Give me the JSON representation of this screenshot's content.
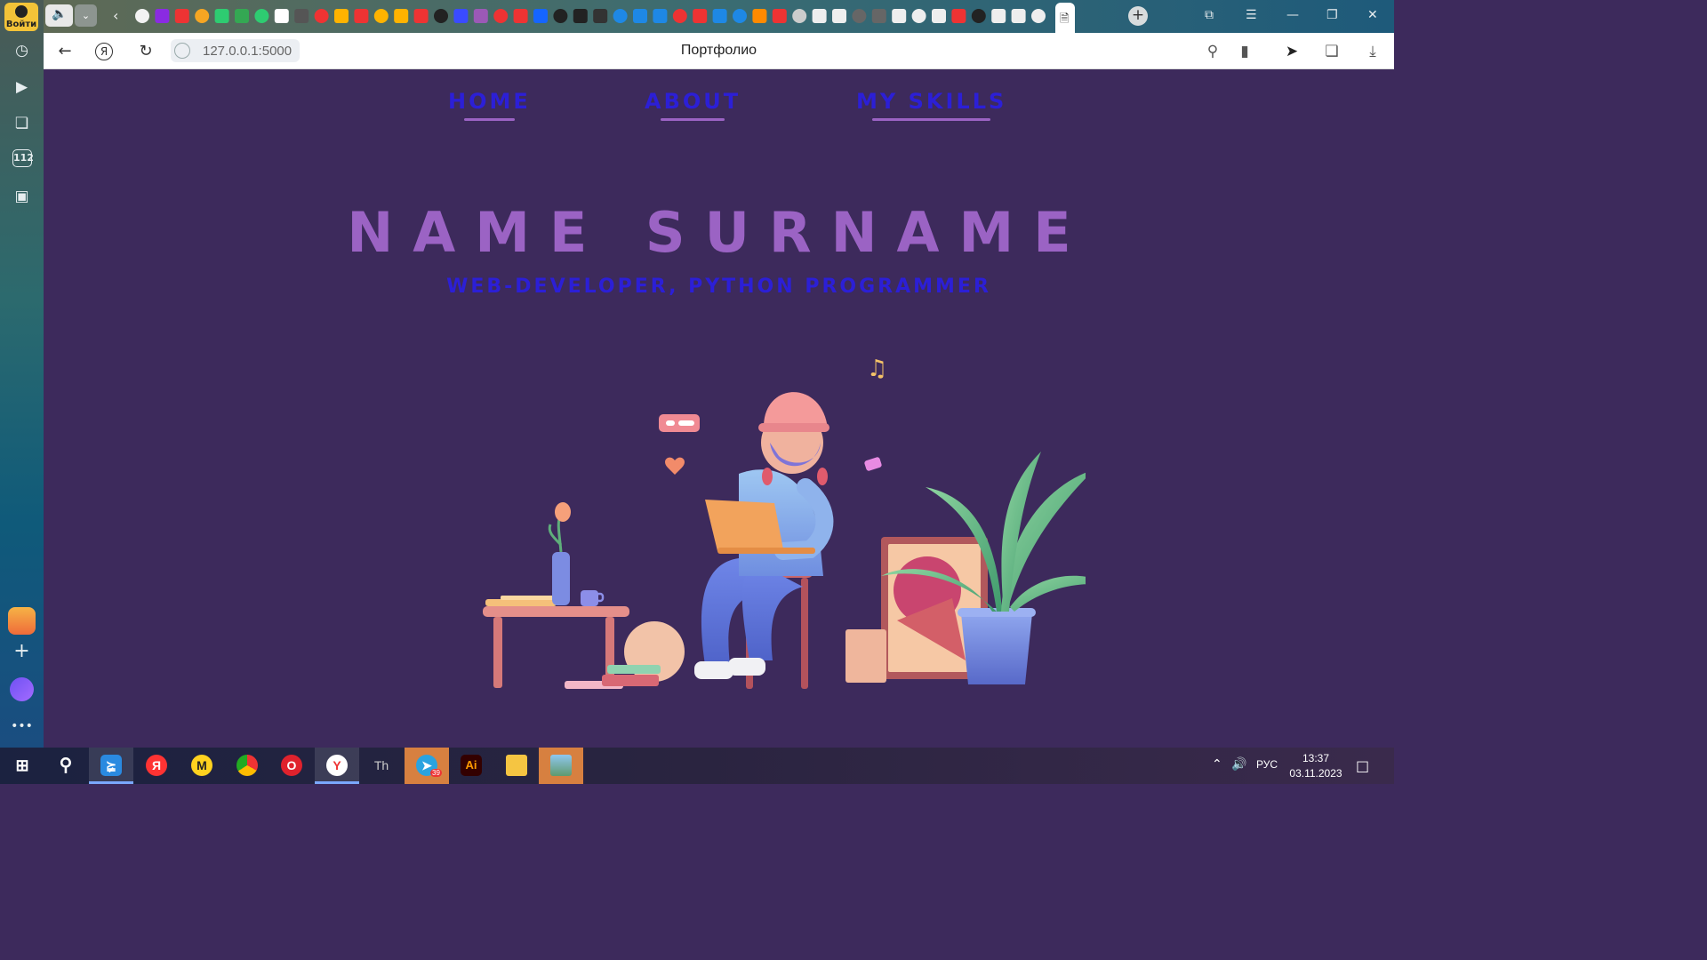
{
  "browser": {
    "sidebar": {
      "login_label": "Войти",
      "items": [
        "history-icon",
        "media-icon",
        "tabs-icon",
        "emergency-112-icon",
        "screenshot-icon"
      ],
      "bottom": [
        "mail-app",
        "add-icon",
        "alice-assistant",
        "more-icon"
      ]
    },
    "tabs": {
      "active_index": 47,
      "new_tab_label": "+"
    },
    "address": {
      "url": "127.0.0.1:5000",
      "page_title": "Портфолио"
    }
  },
  "page": {
    "nav": [
      {
        "label": "HOME"
      },
      {
        "label": "ABOUT"
      },
      {
        "label": "MY SKILLS"
      }
    ],
    "hero": {
      "name": "NAME SURNAME",
      "role": "WEB-DEVELOPER, PYTHON PROGRAMMER"
    },
    "colors": {
      "background": "#3d2a5c",
      "accent_purple": "#9b63c4",
      "accent_blue": "#2c1fd6"
    }
  },
  "taskbar": {
    "apps": [
      "windows-start",
      "search",
      "vscode",
      "yandex",
      "yandex-market",
      "chrome",
      "opera",
      "yandex-browser",
      "text-app",
      "telegram",
      "illustrator",
      "file-explorer",
      "photos"
    ],
    "telegram_badge": "39",
    "illustrator_label": "Ai",
    "language": "РУС",
    "time": "13:37",
    "date": "03.11.2023"
  }
}
